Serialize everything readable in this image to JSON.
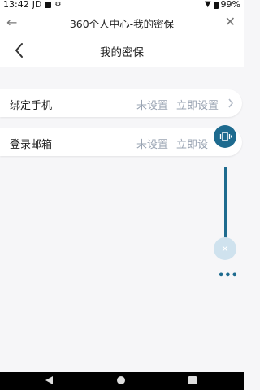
{
  "status_bar": {
    "time": "13:42",
    "carrier": "JD",
    "battery": "99%"
  },
  "browser": {
    "title": "360个人中心-我的密保"
  },
  "header": {
    "title": "我的密保"
  },
  "rows": [
    {
      "label": "绑定手机",
      "status": "未设置",
      "action": "立即设置"
    },
    {
      "label": "登录邮箱",
      "status": "未设置",
      "action": "立即设"
    }
  ],
  "float_menu": {
    "more_label": "•••"
  },
  "colors": {
    "accent": "#1e6b8f",
    "muted_text": "#9aa4b3",
    "background": "#f6f6f8"
  },
  "icons": {
    "browser_back": "arrow-left-icon",
    "browser_close": "close-icon",
    "page_back": "chevron-left-icon",
    "row_arrow": "chevron-right-icon",
    "float_vibrate": "vibrate-icon",
    "float_close": "close-icon"
  }
}
